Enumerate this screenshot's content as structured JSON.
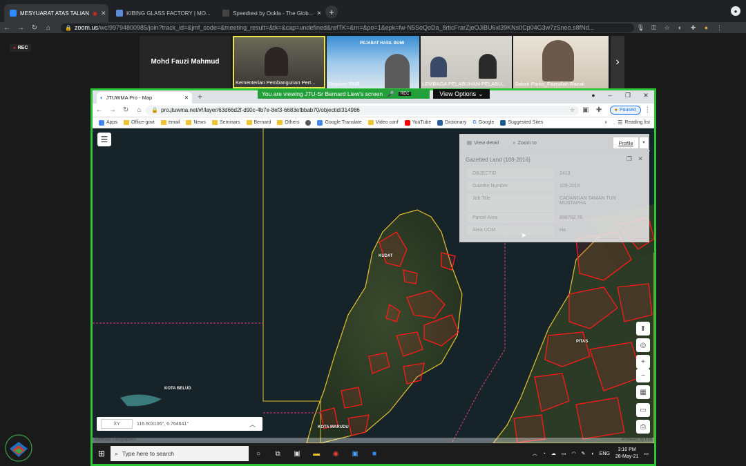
{
  "outer_tabs": [
    {
      "label": "MESYUARAT ATAS TALIAN",
      "active": true
    },
    {
      "label": "KIBING GLASS FACTORY | MO...",
      "active": false
    },
    {
      "label": "Speedtest by Ookla - The Glob...",
      "active": false
    }
  ],
  "outer_url": {
    "host": "zoom.us",
    "rest": "/wc/99794800985/join?track_id=&jmf_code=&meeting_result=&tk=&cap=undefined&refTK=&rn=&po=1&epk=fw-N5SoQoDa_8rticFrarZjeOJiBU6xl39KNs0Cp04G3w7zSneo.s8fNd..."
  },
  "zoom": {
    "rec_label": "REC",
    "participants": [
      {
        "name": "Mohd Fauzi Mahmud"
      },
      {
        "name": "Kementerian Pembangunan Pert..."
      },
      {
        "name": "Stephen PHB"
      },
      {
        "name": "LEMBAGA PELABUHAN-PELABU..."
      },
      {
        "name": "Sabah Parks_Fazrullah Razak"
      }
    ],
    "share_banner": "You are viewing JTU-Sr Bernard Liew's screen",
    "share_rec": "REC",
    "view_options": "View Options"
  },
  "inner": {
    "tab_title": "JTUWMA Pro - Map",
    "url": "pro.jtuwma.net/#!/layer/63d66d2f-d90c-4b7e-8ef3-6683efbbab70/objectid/314986",
    "paused": "Paused",
    "bookmarks": [
      "Apps",
      "Office-govt",
      "email",
      "News",
      "Seminars",
      "Bernard",
      "Others",
      "",
      "Google Translate",
      "Video conf",
      "YouTube",
      "Dictionary",
      "Google",
      "Suggested Sites"
    ],
    "reading_list": "Reading list"
  },
  "popup": {
    "view_detail": "View detail",
    "zoom_to": "Zoom to",
    "profile": "Profile",
    "title": "Gazetted Land (109-2016)",
    "rows": [
      {
        "key": "OBJECTID",
        "value": "2413"
      },
      {
        "key": "Gazette Number",
        "value": "109-2016"
      },
      {
        "key": "Job Title",
        "value": "CADANGAN TAMAN TUN MUSTAPHA"
      },
      {
        "key": "Parcel Area",
        "value": "898762.76"
      },
      {
        "key": "Area UOM",
        "value": "Ha"
      }
    ]
  },
  "map": {
    "places": [
      "KUDAT",
      "PITAS",
      "KOTA BELUD",
      "KOTA MARUDU"
    ],
    "xy_label": "XY",
    "coords": "116.603106°, 6.764641°",
    "attribution_left": "Earthstar Geographics",
    "attribution_right": "Powered by Esri",
    "accent": "#ff1a1a",
    "boundary": "#e6c232"
  },
  "taskbar": {
    "search_placeholder": "Type here to search",
    "lang": "ENG",
    "time": "3:10 PM",
    "date": "28-May-21"
  }
}
